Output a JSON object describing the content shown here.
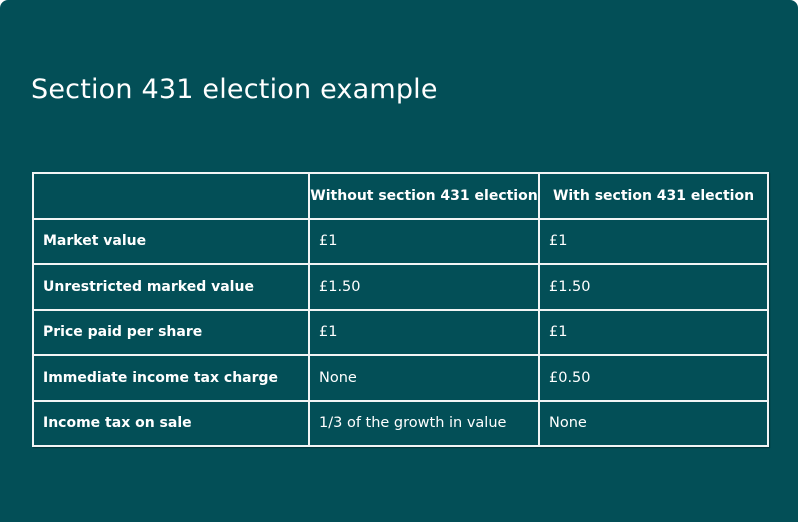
{
  "title": "Section 431 election example",
  "colors": {
    "background": "#034f57",
    "text": "#ffffff",
    "border": "#f2f5f5"
  },
  "table": {
    "headers": [
      "",
      "Without section 431 election",
      "With section 431 election"
    ],
    "rows": [
      {
        "label": "Market value",
        "without": "£1",
        "with": "£1"
      },
      {
        "label": "Unrestricted marked value",
        "without": "£1.50",
        "with": "£1.50"
      },
      {
        "label": "Price paid per share",
        "without": "£1",
        "with": "£1"
      },
      {
        "label": "Immediate income tax charge",
        "without": "None",
        "with": "£0.50"
      },
      {
        "label": "Income tax on sale",
        "without": "1/3 of the growth in value",
        "with": "None"
      }
    ]
  }
}
